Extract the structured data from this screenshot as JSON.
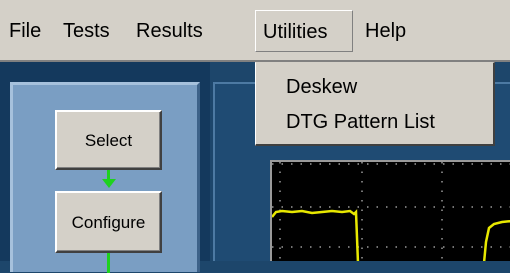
{
  "menubar": {
    "items": [
      {
        "label": "File"
      },
      {
        "label": "Tests"
      },
      {
        "label": "Results"
      },
      {
        "label": "Utilities",
        "open": true
      },
      {
        "label": "Help"
      }
    ]
  },
  "utilities_menu": {
    "items": [
      {
        "label": "Deskew"
      },
      {
        "label": "DTG Pattern List"
      }
    ]
  },
  "nav": {
    "buttons": [
      {
        "label": "Select"
      },
      {
        "label": "Configure"
      }
    ],
    "arrow_color": "#1ed21e"
  },
  "scope": {
    "trace_color": "#e8e800",
    "grid_color": "#9a9a9a"
  }
}
